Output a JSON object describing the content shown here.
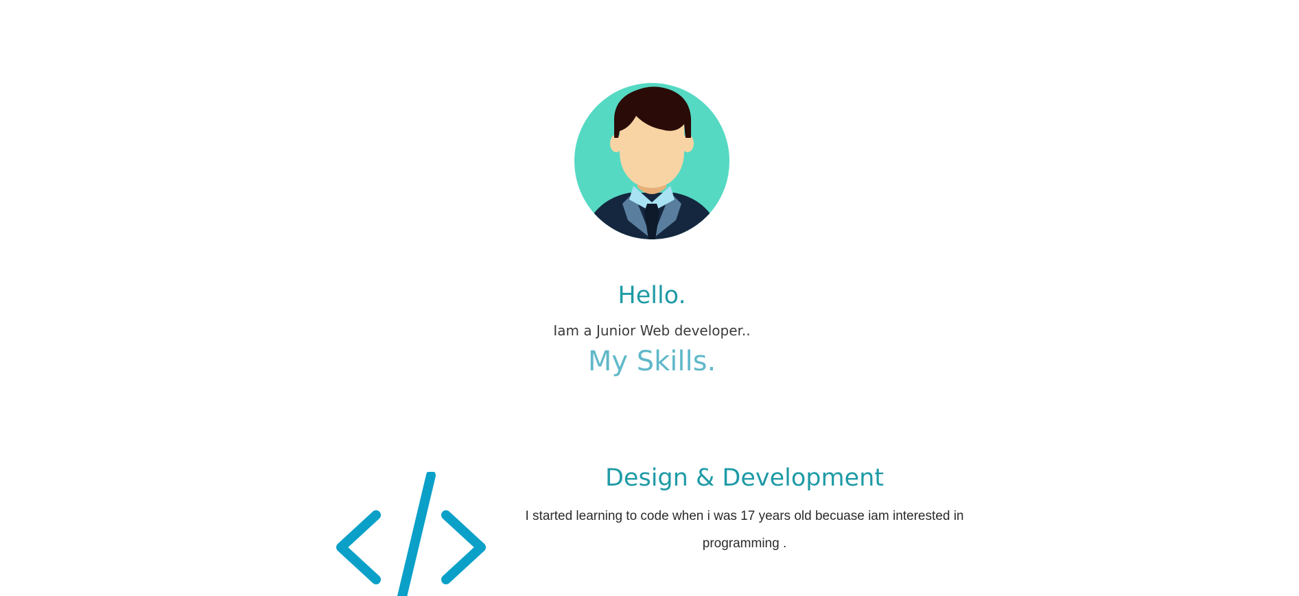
{
  "hero": {
    "greeting": "Hello.",
    "role": "Iam a Junior Web developer..",
    "skills_title": "My Skills."
  },
  "skills": [
    {
      "icon": "code-icon",
      "title": "Design & Development",
      "description": "I started learning to code when i was 17 years old becuase iam interested in programming ."
    }
  ],
  "colors": {
    "accent": "#1e9aa6",
    "accent_light": "#5fb8c9",
    "avatar_bg": "#55d9c3",
    "icon": "#0aa0c8"
  }
}
